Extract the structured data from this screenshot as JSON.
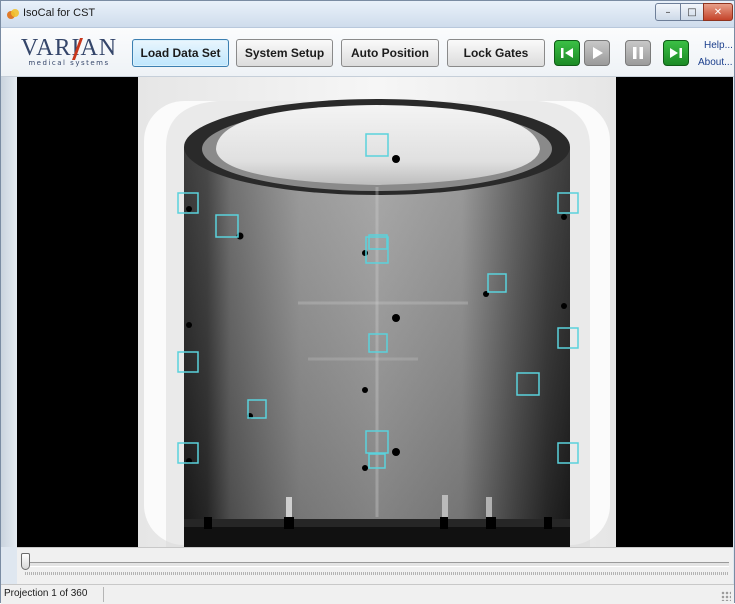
{
  "window": {
    "title": "IsoCal for CST",
    "controls": {
      "minimize": "–",
      "maximize": "□",
      "close": "✕"
    }
  },
  "logo": {
    "main": "VARIAN",
    "sub": "medical systems"
  },
  "toolbar": {
    "load_data_set": "Load Data Set",
    "system_setup": "System Setup",
    "auto_position": "Auto Position",
    "lock_gates": "Lock Gates",
    "media_buttons": [
      {
        "name": "step-back",
        "icon": "step-back-icon",
        "color": "#2aa834"
      },
      {
        "name": "play",
        "icon": "play-icon",
        "color": "#a8a8a8"
      },
      {
        "name": "pause",
        "icon": "pause-icon",
        "color": "#a8a8a8"
      },
      {
        "name": "step-forward",
        "icon": "step-forward-icon",
        "color": "#2aa834"
      }
    ],
    "help_link": "Help...",
    "about_link": "About..."
  },
  "viewer": {
    "image": "kV projection of cylindrical calibration phantom with fiducial markers and cyan detection boxes"
  },
  "trackbar": {
    "position_fraction": 0.0
  },
  "status": {
    "projection": "Projection 1 of 360"
  },
  "colors": {
    "accent_button_border": "#3c7fb1",
    "detection_box": "#5ad2dc",
    "media_green": "#2aa834"
  }
}
